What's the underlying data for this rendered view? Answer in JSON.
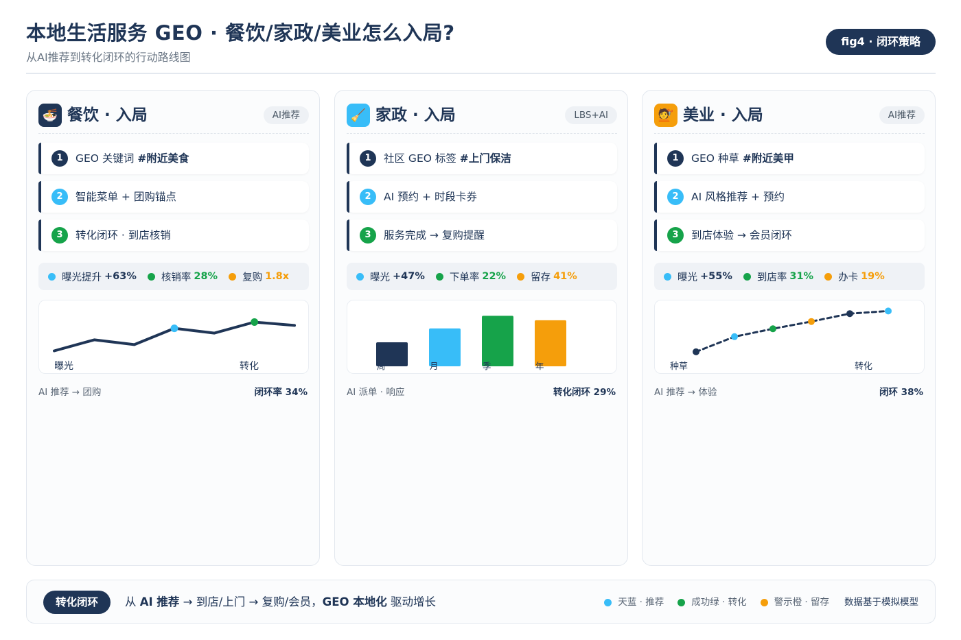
{
  "header": {
    "title": "本地生活服务 GEO · 餐饮/家政/美业怎么入局?",
    "subtitle": "从AI推荐到转化闭环的行动路线图",
    "badge": "fig4 · 闭环策略"
  },
  "colors": {
    "navy": "#1f3556",
    "sky": "#38bdf8",
    "green": "#16a34a",
    "orange": "#f59e0b"
  },
  "cards": [
    {
      "icon": "ramen-bowl-icon",
      "icon_glyph": "🍜",
      "title": "餐饮 · 入局",
      "tag": "AI推荐",
      "steps": [
        {
          "num": "1",
          "text": "GEO 关键词",
          "bold": "#附近美食"
        },
        {
          "num": "2",
          "text": "智能菜单 + 团购锚点",
          "bold": ""
        },
        {
          "num": "3",
          "text": "转化闭环 · 到店核销",
          "bold": ""
        }
      ],
      "metrics": [
        {
          "label": "曝光提升",
          "value": "+63%"
        },
        {
          "label": "核销率",
          "value": "28%"
        },
        {
          "label": "复购",
          "value": "1.8x"
        }
      ],
      "footer_left": "AI 推荐 → 团购",
      "footer_right": "闭环率 34%"
    },
    {
      "icon": "broom-icon",
      "icon_glyph": "🧹",
      "title": "家政 · 入局",
      "tag": "LBS+AI",
      "steps": [
        {
          "num": "1",
          "text": "社区 GEO 标签",
          "bold": "#上门保洁"
        },
        {
          "num": "2",
          "text": "AI 预约 + 时段卡券",
          "bold": ""
        },
        {
          "num": "3",
          "text": "服务完成 → 复购提醒",
          "bold": ""
        }
      ],
      "metrics": [
        {
          "label": "曝光",
          "value": "+47%"
        },
        {
          "label": "下单率",
          "value": "22%"
        },
        {
          "label": "留存",
          "value": "41%"
        }
      ],
      "footer_left": "AI 派单 · 响应",
      "footer_right": "转化闭环 29%"
    },
    {
      "icon": "hairdresser-icon",
      "icon_glyph": "💇",
      "title": "美业 · 入局",
      "tag": "AI推荐",
      "steps": [
        {
          "num": "1",
          "text": "GEO 种草",
          "bold": "#附近美甲"
        },
        {
          "num": "2",
          "text": "AI 风格推荐 + 预约",
          "bold": ""
        },
        {
          "num": "3",
          "text": "到店体验 → 会员闭环",
          "bold": ""
        }
      ],
      "metrics": [
        {
          "label": "曝光",
          "value": "+55%"
        },
        {
          "label": "到店率",
          "value": "31%"
        },
        {
          "label": "办卡",
          "value": "19%"
        }
      ],
      "footer_left": "AI 推荐 → 体验",
      "footer_right": "闭环 38%"
    }
  ],
  "chart_data": [
    {
      "type": "line",
      "x_labels": [
        "曝光",
        "转化"
      ],
      "values": [
        0.15,
        0.38,
        0.28,
        0.62,
        0.52,
        0.75,
        0.68
      ],
      "highlight_indices": [
        3,
        5
      ],
      "highlight_colors": [
        "#38bdf8",
        "#16a34a"
      ]
    },
    {
      "type": "bar",
      "categories": [
        "周",
        "月",
        "季",
        "年"
      ],
      "values": [
        0.38,
        0.6,
        0.8,
        0.73
      ],
      "colors": [
        "#1f3556",
        "#38bdf8",
        "#16a34a",
        "#f59e0b"
      ]
    },
    {
      "type": "line",
      "style": "dashed",
      "x_labels": [
        "种草",
        "转化"
      ],
      "values": [
        0.22,
        0.45,
        0.57,
        0.68,
        0.8,
        0.84
      ],
      "point_colors": [
        "#1f3556",
        "#38bdf8",
        "#16a34a",
        "#f59e0b",
        "#1f3556",
        "#38bdf8"
      ]
    }
  ],
  "bottom": {
    "badge": "转化闭环",
    "text_parts": [
      {
        "t": "从 ",
        "b": false
      },
      {
        "t": "AI 推荐",
        "b": true
      },
      {
        "t": " → 到店/上门 → 复购/会员，",
        "b": false
      },
      {
        "t": "GEO 本地化",
        "b": true
      },
      {
        "t": " 驱动增长",
        "b": false
      }
    ],
    "legend": [
      {
        "label": "天蓝 · 推荐",
        "color": "#38bdf8"
      },
      {
        "label": "成功绿 · 转化",
        "color": "#16a34a"
      },
      {
        "label": "警示橙 · 留存",
        "color": "#f59e0b"
      }
    ],
    "note": "数据基于模拟模型"
  }
}
